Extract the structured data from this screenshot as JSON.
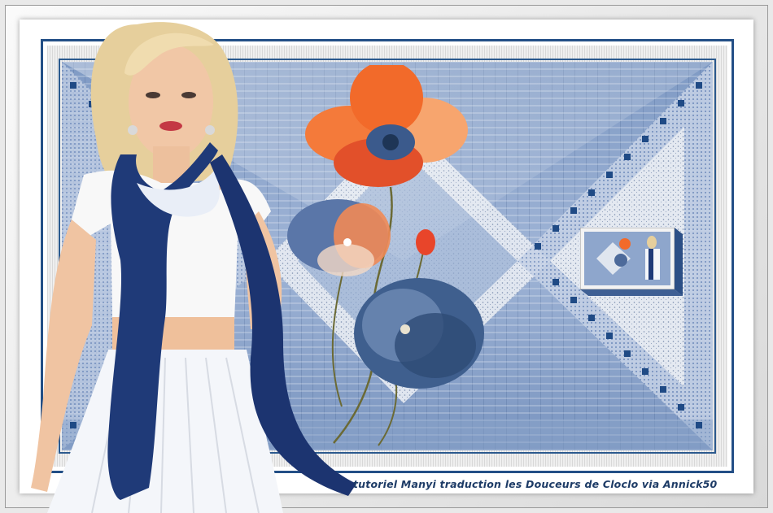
{
  "credit": {
    "text": "tutoriel Manyi traduction les Douceurs de Cloclo  via Annick50"
  },
  "colors": {
    "navy": "#234f86",
    "steel_blue": "#8ea6cc",
    "poppy_orange": "#f26a2a",
    "white": "#ffffff"
  },
  "imagery": {
    "woman": "woman-in-white-top-with-navy-scarf",
    "flowers": "orange-and-blue-poppies",
    "thumbnail": "miniature-of-main-artwork"
  }
}
